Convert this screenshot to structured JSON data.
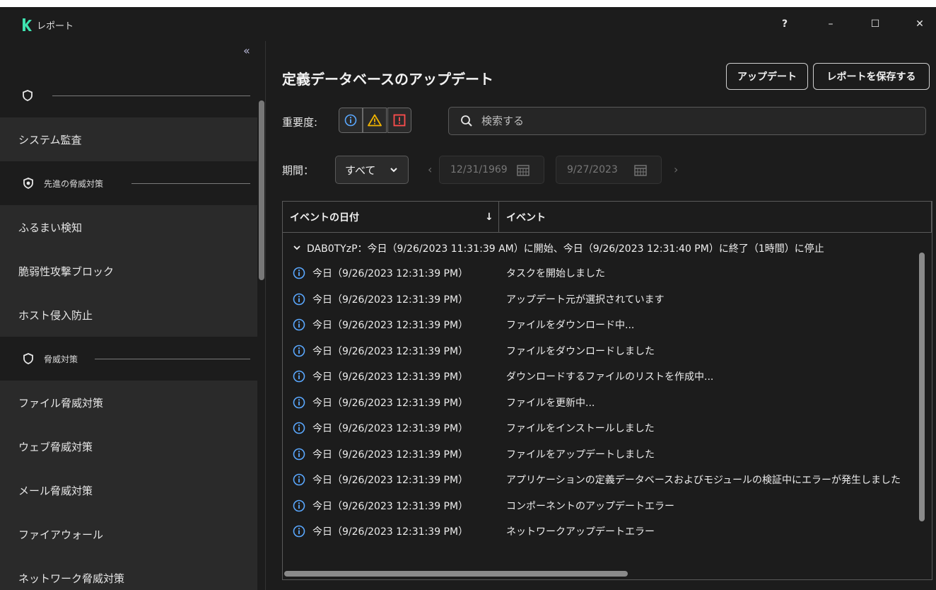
{
  "window": {
    "title": "レポート",
    "help": "?",
    "minimize": "–",
    "maximize": "☐",
    "close": "✕"
  },
  "sidebar": {
    "collapse_label": "«",
    "sections": [
      {
        "label": ""
      },
      {
        "label": "先進の脅威対策"
      },
      {
        "label": "脅威対策"
      }
    ],
    "items": [
      {
        "label": "システム監査"
      },
      {
        "label": "ふるまい検知"
      },
      {
        "label": "脆弱性攻撃ブロック"
      },
      {
        "label": "ホスト侵入防止"
      },
      {
        "label": "ファイル脅威対策"
      },
      {
        "label": "ウェブ脅威対策"
      },
      {
        "label": "メール脅威対策"
      },
      {
        "label": "ファイアウォール"
      },
      {
        "label": "ネットワーク脅威対策"
      }
    ]
  },
  "main": {
    "title": "定義データベースのアップデート",
    "update_button": "アップデート",
    "save_button": "レポートを保存する",
    "severity_label": "重要度:",
    "search_placeholder": "検索する",
    "period_label": "期間：",
    "period_value": "すべて",
    "date_from": "12/31/1969",
    "date_to": "9/27/2023",
    "nav_prev": "‹",
    "nav_next": "›"
  },
  "table": {
    "col_date": "イベントの日付",
    "col_event": "イベント",
    "sort_indicator": "↓",
    "group": "DAB0TYzP：今日（9/26/2023 11:31:39 AM）に開始、今日（9/26/2023 12:31:40 PM）に終了（1時間）に停止",
    "rows": [
      {
        "date": "今日（9/26/2023 12:31:39 PM）",
        "event": "タスクを開始しました"
      },
      {
        "date": "今日（9/26/2023 12:31:39 PM）",
        "event": "アップデート元が選択されています"
      },
      {
        "date": "今日（9/26/2023 12:31:39 PM）",
        "event": "ファイルをダウンロード中..."
      },
      {
        "date": "今日（9/26/2023 12:31:39 PM）",
        "event": "ファイルをダウンロードしました"
      },
      {
        "date": "今日（9/26/2023 12:31:39 PM）",
        "event": "ダウンロードするファイルのリストを作成中..."
      },
      {
        "date": "今日（9/26/2023 12:31:39 PM）",
        "event": "ファイルを更新中..."
      },
      {
        "date": "今日（9/26/2023 12:31:39 PM）",
        "event": "ファイルをインストールしました"
      },
      {
        "date": "今日（9/26/2023 12:31:39 PM）",
        "event": "ファイルをアップデートしました"
      },
      {
        "date": "今日（9/26/2023 12:31:39 PM）",
        "event": "アプリケーションの定義データベースおよびモジュールの検証中にエラーが発生しました"
      },
      {
        "date": "今日（9/26/2023 12:31:39 PM）",
        "event": "コンポーネントのアップデートエラー"
      },
      {
        "date": "今日（9/26/2023 12:31:39 PM）",
        "event": "ネットワークアップデートエラー"
      }
    ]
  },
  "colors": {
    "accent": "#3ee3b0",
    "info": "#5aa8ff",
    "warning": "#f2b400",
    "critical": "#ff4d4d"
  },
  "icons": {
    "logo": "kaspersky-k-icon",
    "shield": "shield-icon",
    "info": "info-circle-icon",
    "warning": "warning-triangle-icon",
    "critical": "critical-square-icon",
    "search": "search-icon",
    "calendar": "calendar-icon"
  }
}
